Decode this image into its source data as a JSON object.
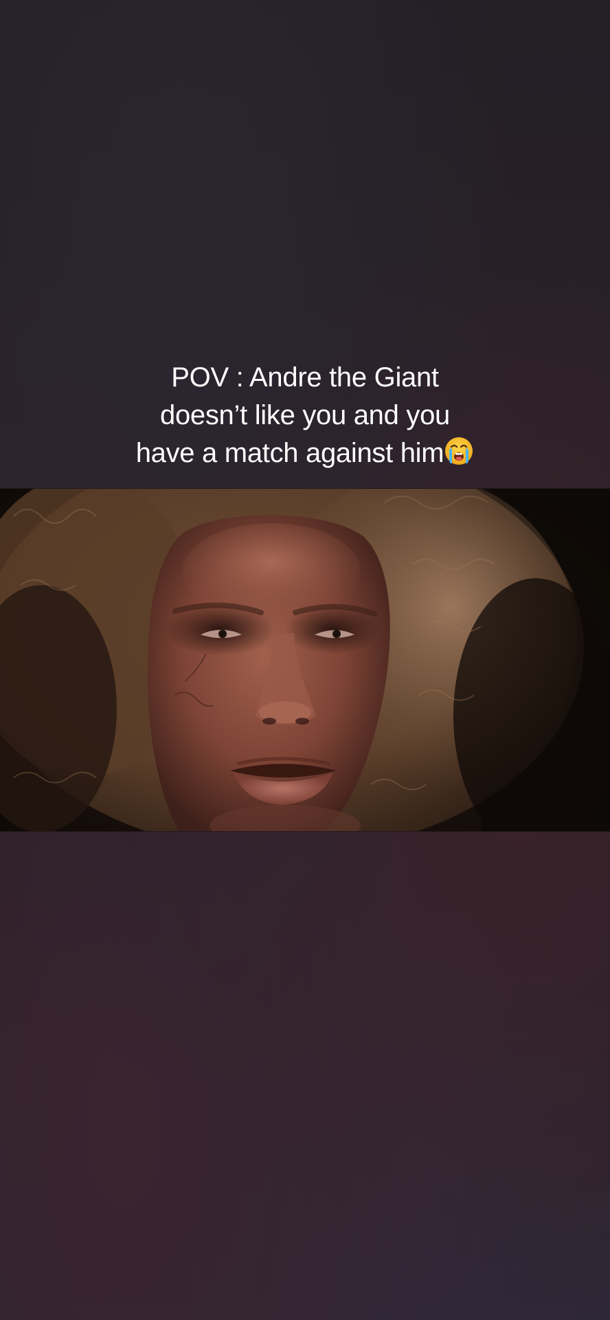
{
  "caption": {
    "line1": "POV : Andre the Giant",
    "line2": "doesn’t like you and you",
    "line3": "have a match against him"
  },
  "caption_emoji": "loudly-crying-face-emoji",
  "video": {
    "subject": "close-up-face-with-curly-hair"
  },
  "colors": {
    "background": "#241d24",
    "caption_text": "#ffffff",
    "hair": "#7a5a40",
    "skin": "#8a4a3a"
  }
}
